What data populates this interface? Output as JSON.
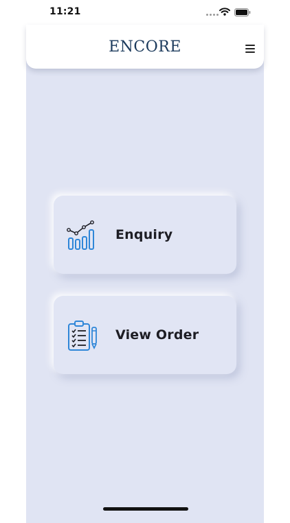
{
  "status_bar": {
    "time": "11:21",
    "icons": [
      "signal-dots-icon",
      "wifi-icon",
      "battery-icon"
    ]
  },
  "header": {
    "title": "ENCORE",
    "menu_icon": "hamburger-menu-icon"
  },
  "tiles": [
    {
      "label": "Enquiry",
      "icon": "bar-chart-trend-icon"
    },
    {
      "label": "View Order",
      "icon": "clipboard-checklist-pen-icon"
    }
  ],
  "colors": {
    "canvas_background": "#e0e4f3",
    "title_color": "#1b3a5c",
    "icon_blue": "#2e86d8",
    "icon_dark": "#1d1d24"
  }
}
